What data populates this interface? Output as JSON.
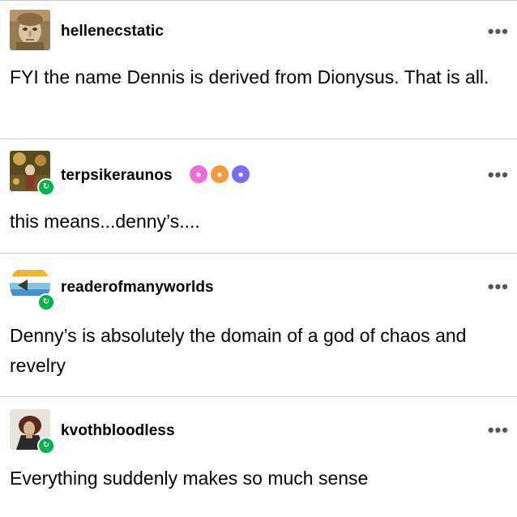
{
  "posts": [
    {
      "username": "hellenecstatic",
      "text": "FYI the name Dennis is derived from Dionysus. That is all.",
      "menu": "•••",
      "avatar": "statue-head-avatar"
    },
    {
      "username": "terpsikeraunos",
      "text": "this means...denny’s....",
      "menu": "•••",
      "avatar": "painting-avatar",
      "badges": [
        {
          "name": "pink-paw-badge",
          "color": "#f06ad8"
        },
        {
          "name": "orange-paw-badge",
          "color": "#f59a3a"
        },
        {
          "name": "purple-paw-badge",
          "color": "#7b6cf6"
        }
      ]
    },
    {
      "username": "readerofmanyworlds",
      "text": "Denny’s is absolutely the domain of a god of chaos and revelry",
      "menu": "•••",
      "avatar": "flag-stripes-avatar"
    },
    {
      "username": "kvothbloodless",
      "text": "Everything suddenly makes so much sense",
      "menu": "•••",
      "avatar": "portrait-avatar"
    }
  ],
  "colors": {
    "reblog_green": "#00b24a",
    "divider": "#cfcfcf"
  }
}
